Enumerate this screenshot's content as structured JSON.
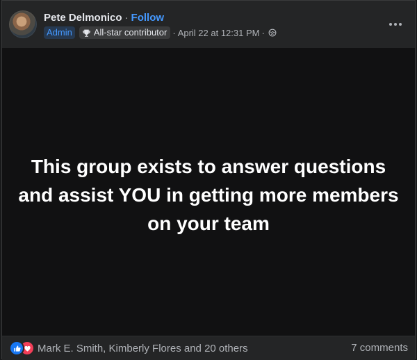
{
  "post": {
    "author": {
      "name": "Pete Delmonico",
      "follow_label": "Follow",
      "separator": "·"
    },
    "meta": {
      "admin_badge": "Admin",
      "contributor_badge": "All-star contributor",
      "timestamp": "April 22 at 12:31 PM",
      "separator": "·",
      "privacy_icon": "globe-icon"
    },
    "more_icon": "ellipsis-icon",
    "content_text": "This group exists to answer questions and assist YOU in getting more members on your team",
    "footer": {
      "reaction_icons": [
        "like-icon",
        "love-icon"
      ],
      "reaction_names": "Mark E. Smith, Kimberly Flores and 20 others",
      "comments_count": "7 comments"
    }
  },
  "colors": {
    "accent_blue": "#4599ff",
    "card_bg": "#242526",
    "content_bg": "#111112",
    "like": "#1877f2",
    "love": "#f33e58"
  }
}
